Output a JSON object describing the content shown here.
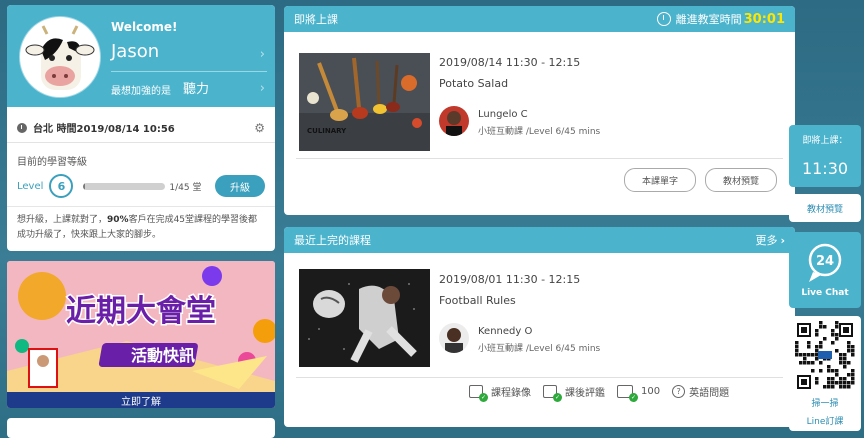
{
  "profile": {
    "welcome": "Welcome!",
    "name": "Jason",
    "weak_label": "最想加強的是",
    "weak_value": "聽力",
    "time_text": "台北 時間2019/08/14 10:56",
    "level_title": "目前的學習等級",
    "level_label": "Level",
    "level_value": "6",
    "progress_fraction": 0.022,
    "progress_text": "1/45 堂",
    "upgrade_label": "升級",
    "promo_text": "想升級，上課就對了，90%客戶在完成45堂課程的學習後都成功升級了，快來跟上大家的腳步。",
    "promo_highlight": "90%",
    "avatar_icon": "cow-avatar"
  },
  "banner": {
    "title_line1": "近期大會堂",
    "title_line2": "活動快訊",
    "cta": "立即了解",
    "bg_color": "#f3b7c1",
    "accent_color": "#6a1fa8"
  },
  "upcoming": {
    "header_title": "即將上課",
    "countdown_label": "離進教室時間",
    "countdown_value": "30:01",
    "lesson": {
      "time": "2019/08/14 11:30 - 12:15",
      "name": "Potato Salad",
      "thumb_caption": "CULINARY",
      "teacher": "Lungelo C",
      "meta": "小班互動課 /Level 6/45 mins"
    },
    "buttons": [
      "本課單字",
      "教材預覽"
    ]
  },
  "recent": {
    "header_title": "最近上完的課程",
    "more_label": "更多",
    "lesson": {
      "time": "2019/08/01 11:30 - 12:15",
      "name": "Football Rules",
      "teacher": "Kennedy O",
      "meta": "小班互動課 /Level 6/45 mins"
    },
    "actions": {
      "video": "課程錄像",
      "review": "課後評鑑",
      "vocab_count": "100",
      "question": "英語問題"
    }
  },
  "sidebar": {
    "next_label": "即將上課：",
    "next_time": "11:30",
    "preview_label": "教材預覽",
    "livechat_number": "24",
    "livechat_label": "Live Chat",
    "qr_label1": "掃一掃",
    "qr_label2": "Line訂課"
  },
  "colors": {
    "primary": "#4bb3cc",
    "countdown": "#ffe600",
    "check": "#2eaa3c",
    "page_bg": "#2f6f86"
  }
}
